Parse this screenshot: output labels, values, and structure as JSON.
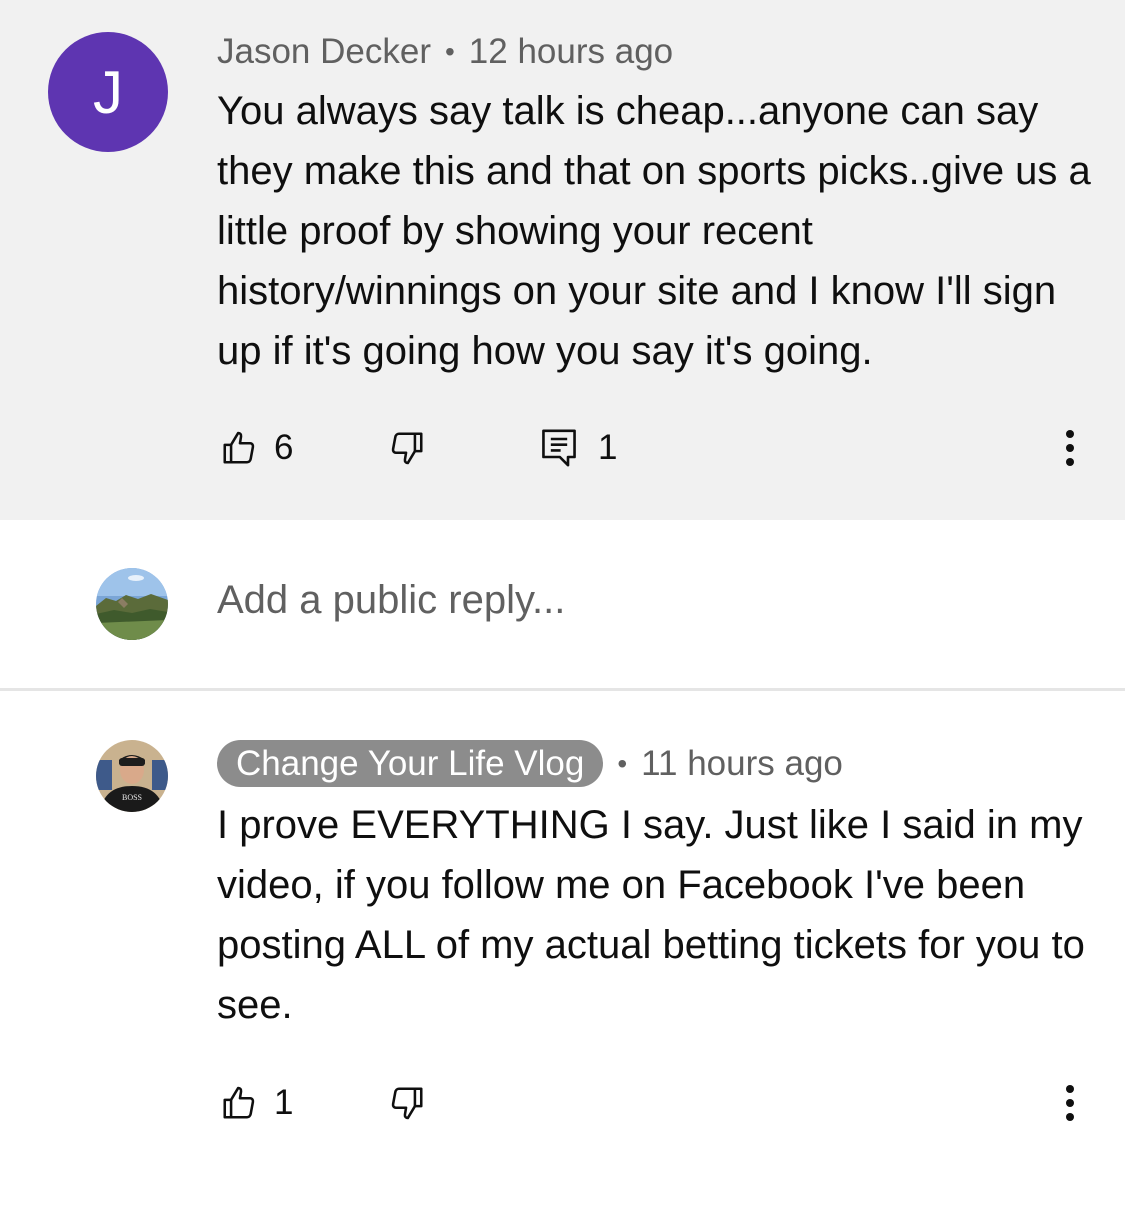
{
  "comment": {
    "avatar_letter": "J",
    "author": "Jason Decker",
    "separator": "•",
    "time": "12 hours ago",
    "text": "You always say talk is cheap...anyone can say they make this and that on sports picks..give us a little proof by showing your recent history/winnings on your site and I know I'll sign up if it's going how you say it's going.",
    "likes": "6",
    "replies": "1",
    "icons": {
      "like": "thumbs-up-icon",
      "dislike": "thumbs-down-icon",
      "reply": "comment-reply-icon",
      "more": "more-vertical-icon"
    }
  },
  "reply_box": {
    "placeholder": "Add a public reply..."
  },
  "reply": {
    "author": "Change Your Life Vlog",
    "separator": "•",
    "time": "11 hours ago",
    "text": "I prove EVERYTHING I say. Just like I said in my video, if you follow me on Facebook I've been posting ALL of my actual betting tickets for you to see.",
    "likes": "1",
    "avatar_hat_text": "BOSS"
  },
  "colors": {
    "avatar_bg": "#5e35b1",
    "comment_bg": "#f1f1f1",
    "author_chip_bg": "#8c8c8c",
    "meta_text": "#606060"
  }
}
